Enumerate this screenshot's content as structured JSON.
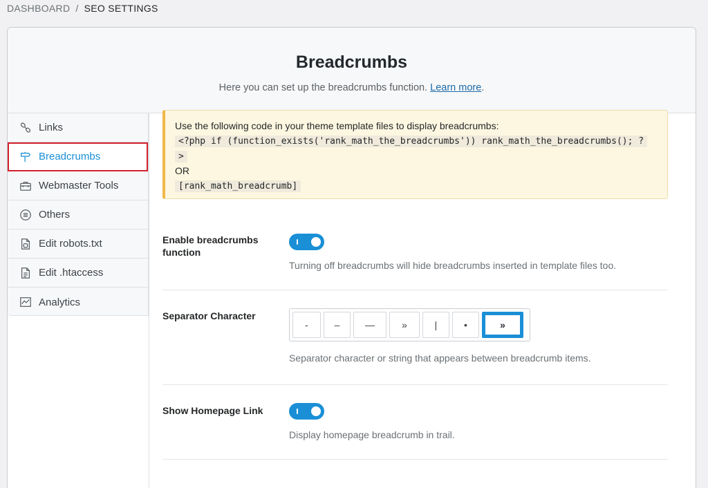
{
  "breadcrumb": {
    "root": "DASHBOARD",
    "separator": "/",
    "current": "SEO SETTINGS"
  },
  "header": {
    "title": "Breadcrumbs",
    "description": "Here you can set up the breadcrumbs function.",
    "learn_more": "Learn more",
    "period": "."
  },
  "sidebar": {
    "items": [
      {
        "label": "Links",
        "icon": "link-icon"
      },
      {
        "label": "Breadcrumbs",
        "icon": "signpost-icon",
        "active": true
      },
      {
        "label": "Webmaster Tools",
        "icon": "toolbox-icon"
      },
      {
        "label": "Others",
        "icon": "list-circle-icon"
      },
      {
        "label": "Edit robots.txt",
        "icon": "robot-file-icon"
      },
      {
        "label": "Edit .htaccess",
        "icon": "document-icon"
      },
      {
        "label": "Analytics",
        "icon": "chart-icon"
      }
    ]
  },
  "notice": {
    "intro": "Use the following code in your theme template files to display breadcrumbs:",
    "php_code_line1": "<?php if (function_exists('rank_math_the_breadcrumbs')) rank_math_the_breadcrumbs(); ?",
    "php_code_line2": ">",
    "or": "OR",
    "shortcode": "[rank_math_breadcrumb]"
  },
  "settings": {
    "enable": {
      "label": "Enable breadcrumbs function",
      "enabled": true,
      "description": "Turning off breadcrumbs will hide breadcrumbs inserted in template files too."
    },
    "separator": {
      "label": "Separator Character",
      "options": [
        "-",
        "–",
        "—",
        "»",
        "|",
        "•",
        "»"
      ],
      "selected_index": 6,
      "description": "Separator character or string that appears between breadcrumb items."
    },
    "homepage": {
      "label": "Show Homepage Link",
      "enabled": true,
      "description": "Display homepage breadcrumb in trail."
    }
  },
  "colors": {
    "accent": "#1a8fd6",
    "highlight_border": "#d4202c",
    "notice_border": "#f0b849"
  }
}
